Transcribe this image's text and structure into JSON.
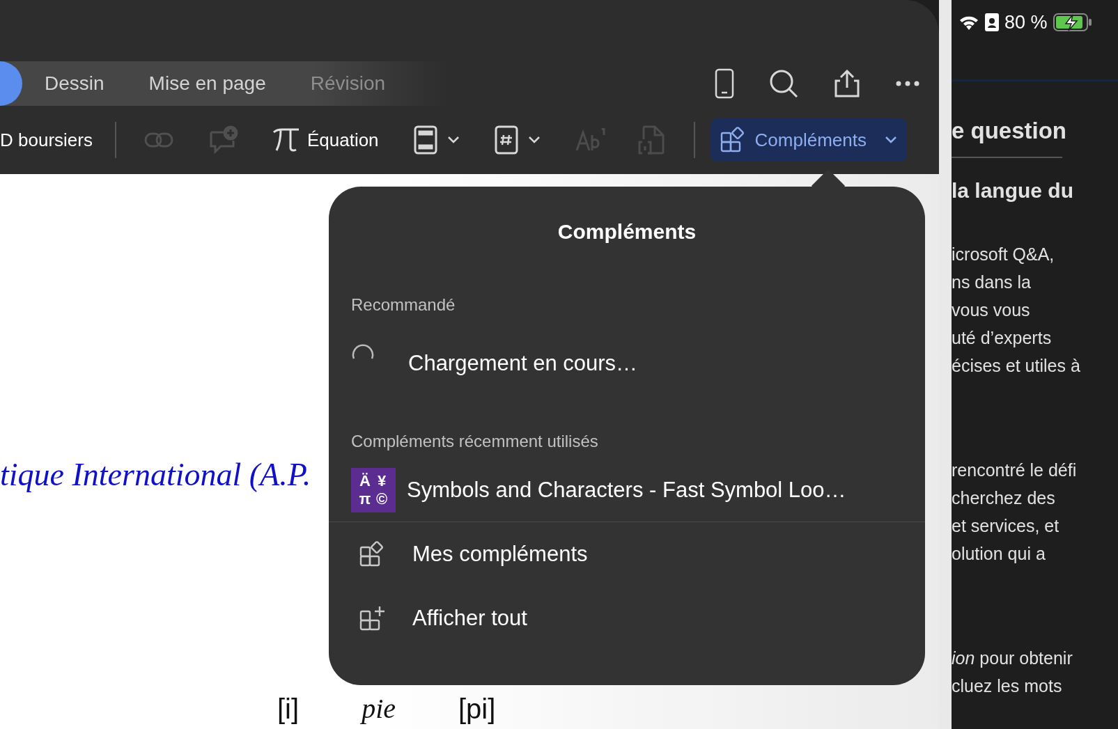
{
  "status_bar": {
    "battery_text": "80 %"
  },
  "tabs": [
    {
      "label": "Dessin",
      "selected": false
    },
    {
      "label": "Mise en page",
      "selected": false
    },
    {
      "label": "Révision",
      "selected": false
    }
  ],
  "toolbar": {
    "partial_label": "D boursiers",
    "equation_label": "Équation",
    "addins_button": {
      "label": "Compléments",
      "expanded": true
    }
  },
  "document": {
    "heading_fragment": "tique International (A.P.",
    "bottom_row": [
      "[i]",
      "pie",
      "[pi]"
    ]
  },
  "popover": {
    "title": "Compléments",
    "sections": [
      {
        "header": "Recommandé",
        "items": [
          {
            "kind": "loading",
            "label": "Chargement en cours…"
          }
        ]
      },
      {
        "header": "Compléments récemment utilisés",
        "items": [
          {
            "kind": "addin",
            "label": "Symbols and Characters - Fast Symbol Loo…",
            "icon_glyphs": [
              "Ä",
              "¥",
              "π",
              "©"
            ]
          }
        ]
      }
    ],
    "actions": [
      {
        "kind": "mine",
        "label": "Mes compléments"
      },
      {
        "kind": "all",
        "label": "Afficher tout"
      }
    ]
  },
  "side_panel": {
    "title": "e question",
    "subtitle": "la langue du",
    "paragraphs": [
      [
        "icrosoft Q&A,",
        "ns dans la",
        "vous vous",
        "uté d’experts",
        "écises et utiles à"
      ],
      [
        "rencontré le défi",
        "cherchez des",
        "et services, et",
        "olution qui a"
      ],
      [
        "*ion* pour obtenir",
        "cluez les mots"
      ]
    ]
  }
}
